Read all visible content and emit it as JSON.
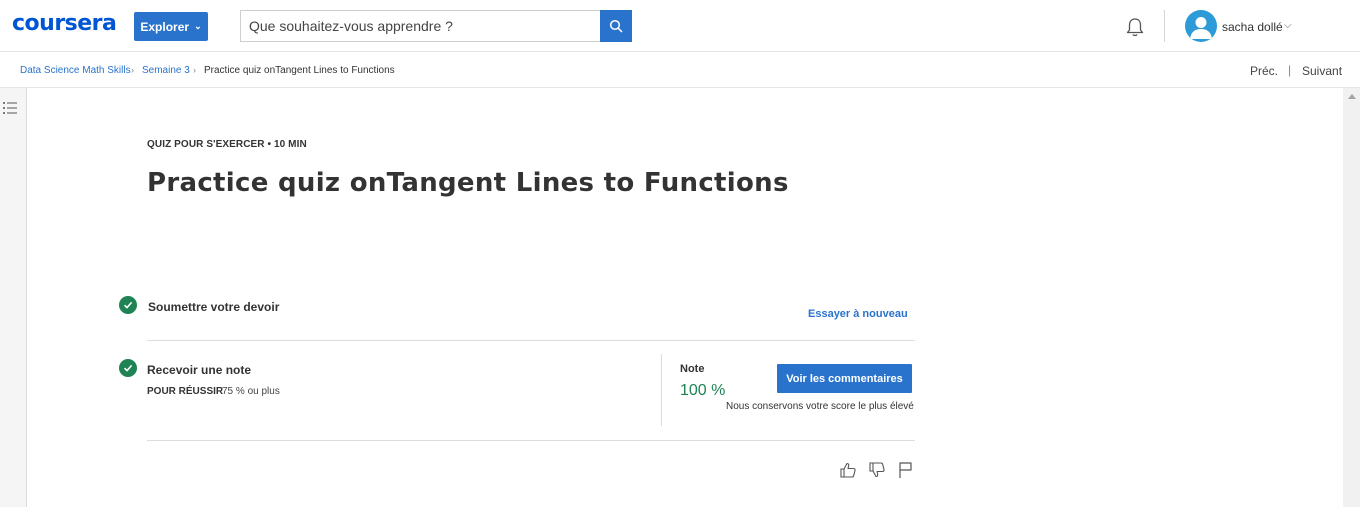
{
  "header": {
    "logo": "coursera",
    "explore_label": "Explorer",
    "search_placeholder": "Que souhaitez-vous apprendre ?",
    "username": "sacha dollé"
  },
  "breadcrumb": {
    "items": [
      "Data Science Math Skills",
      "Semaine 3",
      "Practice quiz onTangent Lines to Functions"
    ],
    "separator": "›"
  },
  "nav": {
    "prev": "Préc.",
    "separator": "|",
    "next": "Suivant"
  },
  "quiz": {
    "eyebrow": "QUIZ POUR S'EXERCER • 10  MIN",
    "title": "Practice quiz onTangent Lines to Functions"
  },
  "steps": {
    "submit": {
      "label": "Soumettre votre devoir",
      "action": "Essayer à nouveau"
    },
    "grade": {
      "label": "Recevoir une note",
      "pass_label": "POUR RÉUSSIR",
      "pass_value": "75 % ou plus",
      "note_label": "Note",
      "note_value": "100 %",
      "feedback_button": "Voir les commentaires",
      "keep_note": "Nous conservons votre score le plus élevé"
    }
  },
  "colors": {
    "brand": "#0056d2",
    "accent": "#2a73cc",
    "success": "#1f8354"
  },
  "icons": [
    "search-icon",
    "bell-icon",
    "avatar-icon",
    "list-icon",
    "check-icon",
    "thumbs-up-icon",
    "thumbs-down-icon",
    "flag-icon"
  ]
}
